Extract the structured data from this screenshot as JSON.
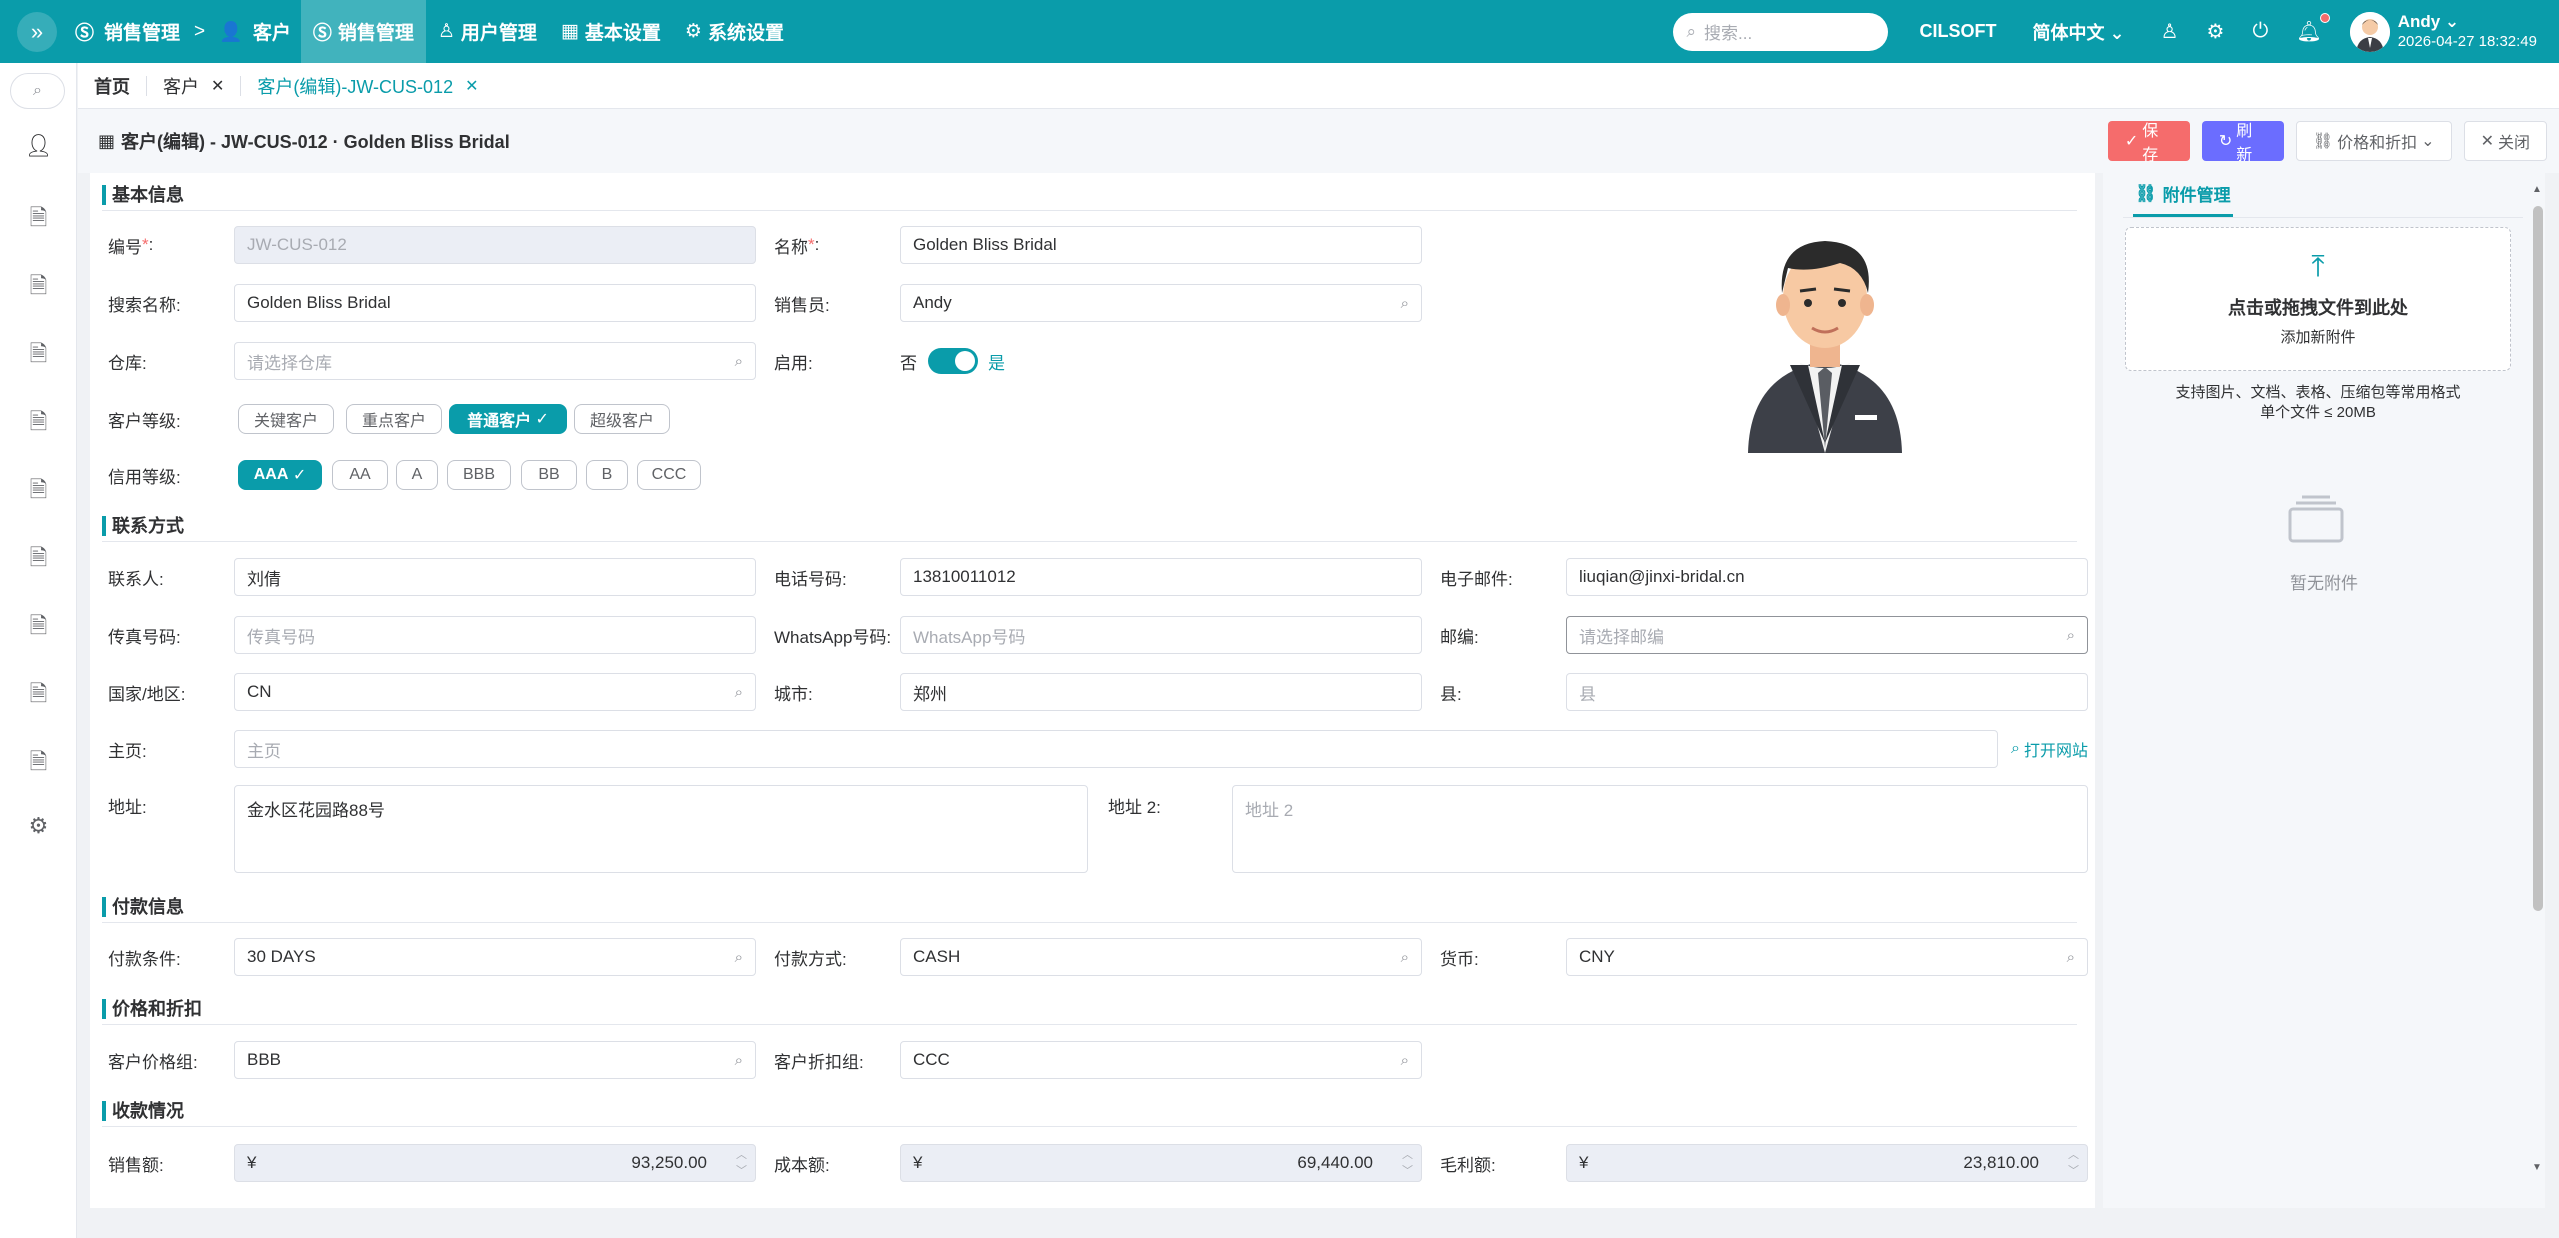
{
  "topbar": {
    "crumb_root": "销售管理",
    "crumb_sep": ">",
    "crumb_current": "客户",
    "nav": [
      "销售管理",
      "用户管理",
      "基本设置",
      "系统设置"
    ],
    "search_placeholder": "搜索...",
    "brand": "CILSOFT",
    "language": "简体中文",
    "user_name": "Andy",
    "user_time": "2026-04-27 18:32:49",
    "accent_color": "#0a9caa"
  },
  "tabs": [
    {
      "label": "首页"
    },
    {
      "label": "客户"
    },
    {
      "label": "客户(编辑)-JW-CUS-012"
    }
  ],
  "page": {
    "title": "客户(编辑) - JW-CUS-012 · Golden Bliss Bridal",
    "btn_save": "保存",
    "btn_refresh": "刷新",
    "btn_price": "价格和折扣",
    "btn_close": "关闭"
  },
  "form": {
    "sec_basic": "基本信息",
    "code_label": "编号",
    "code_value": "JW-CUS-012",
    "name_label": "名称",
    "name_value": "Golden Bliss Bridal",
    "search_name_label": "搜索名称:",
    "search_name_value": "Golden Bliss Bridal",
    "salesman_label": "销售员:",
    "salesman_value": "Andy",
    "warehouse_label": "仓库:",
    "warehouse_placeholder": "请选择仓库",
    "enabled_label": "启用:",
    "enabled_off": "否",
    "enabled_on": "是",
    "customer_level_label": "客户等级:",
    "customer_levels": [
      "关键客户",
      "重点客户",
      "普通客户",
      "超级客户"
    ],
    "customer_level_selected": "普通客户",
    "credit_level_label": "信用等级:",
    "credit_levels": [
      "AAA",
      "AA",
      "A",
      "BBB",
      "BB",
      "B",
      "CCC"
    ],
    "credit_level_selected": "AAA",
    "sec_contact": "联系方式",
    "contact_label": "联系人:",
    "contact_value": "刘倩",
    "phone_label": "电话号码:",
    "phone_value": "13810011012",
    "email_label": "电子邮件:",
    "email_value": "liuqian@jinxi-bridal.cn",
    "fax_label": "传真号码:",
    "fax_placeholder": "传真号码",
    "whatsapp_label": "WhatsApp号码:",
    "whatsapp_placeholder": "WhatsApp号码",
    "zip_label": "邮编:",
    "zip_placeholder": "请选择邮编",
    "country_label": "国家/地区:",
    "country_value": "CN",
    "city_label": "城市:",
    "city_value": "郑州",
    "county_label": "县:",
    "county_placeholder": "县",
    "homepage_label": "主页:",
    "homepage_placeholder": "主页",
    "open_site": "打开网站",
    "address_label": "地址:",
    "address_value": "金水区花园路88号",
    "address2_label": "地址 2:",
    "address2_placeholder": "地址 2",
    "sec_payment": "付款信息",
    "pay_terms_label": "付款条件:",
    "pay_terms_value": "30 DAYS",
    "pay_method_label": "付款方式:",
    "pay_method_value": "CASH",
    "currency_label": "货币:",
    "currency_value": "CNY",
    "sec_price": "价格和折扣",
    "price_group_label": "客户价格组:",
    "price_group_value": "BBB",
    "discount_group_label": "客户折扣组:",
    "discount_group_value": "CCC",
    "sec_receipt": "收款情况",
    "sales_label": "销售额:",
    "sales_value": "93,250.00",
    "cost_label": "成本额:",
    "cost_value": "69,440.00",
    "gross_label": "毛利额:",
    "gross_value": "23,810.00",
    "currency_symbol": "¥"
  },
  "attachments": {
    "tab": "附件管理",
    "drop_title": "点击或拖拽文件到此处",
    "drop_sub": "添加新附件",
    "hint1": "支持图片、文档、表格、压缩包等常用格式",
    "hint2": "单个文件 ≤ 20MB",
    "empty": "暂无附件"
  }
}
